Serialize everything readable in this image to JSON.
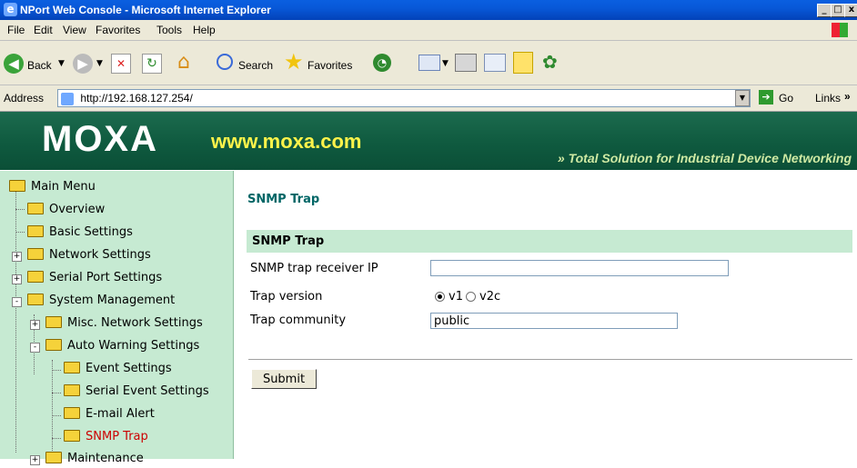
{
  "window": {
    "title": "NPort Web Console - Microsoft Internet Explorer",
    "controls": [
      "_",
      "□",
      "x"
    ]
  },
  "menubar": {
    "items": [
      "File",
      "Edit",
      "View",
      "Favorites",
      "Tools",
      "Help"
    ]
  },
  "toolbar": {
    "back_label": "Back",
    "search_label": "Search",
    "favorites_label": "Favorites"
  },
  "address": {
    "label": "Address",
    "url": "http://192.168.127.254/",
    "go_label": "Go",
    "links_label": "Links",
    "links_chevron": "»"
  },
  "banner": {
    "logo": "MOXA",
    "site": "www.moxa.com",
    "tagline": "»  Total Solution for Industrial Device Networking",
    "colors": {
      "banner": "#0f5a3f",
      "site": "#fff34a"
    }
  },
  "sidebar": {
    "items": [
      {
        "label": "Main Menu",
        "expander": ""
      },
      {
        "label": "Overview",
        "expander": ""
      },
      {
        "label": "Basic Settings",
        "expander": ""
      },
      {
        "label": "Network Settings",
        "expander": "+"
      },
      {
        "label": "Serial Port Settings",
        "expander": "+"
      },
      {
        "label": "System Management",
        "expander": "-"
      },
      {
        "label": "Misc. Network Settings",
        "expander": "+"
      },
      {
        "label": "Auto Warning Settings",
        "expander": "-"
      },
      {
        "label": "Event Settings",
        "expander": ""
      },
      {
        "label": "Serial Event Settings",
        "expander": ""
      },
      {
        "label": "E-mail Alert",
        "expander": ""
      },
      {
        "label": "SNMP Trap",
        "expander": "",
        "active": true
      },
      {
        "label": "Maintenance",
        "expander": "+"
      }
    ],
    "active_color": "#cc0000"
  },
  "content": {
    "page_title": "SNMP Trap",
    "section_header": "SNMP Trap",
    "fields": {
      "receiver_ip_label": "SNMP trap receiver IP",
      "receiver_ip_value": "",
      "trap_version_label": "Trap version",
      "version_v1": "v1",
      "version_v2c": "v2c",
      "selected_version": "v1",
      "community_label": "Trap community",
      "community_value": "public"
    },
    "submit_label": "Submit",
    "colors": {
      "title": "#006666",
      "section_bg": "#c6ead2"
    }
  }
}
